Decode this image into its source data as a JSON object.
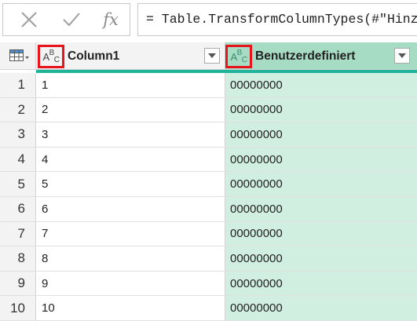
{
  "formula_bar": {
    "cancel_icon": "x-icon",
    "commit_icon": "check-icon",
    "fx_label": "fx",
    "formula": "= Table.TransformColumnTypes(#\"Hinz"
  },
  "table": {
    "corner_icon": "table-icon",
    "columns": [
      {
        "type_label": "ABC",
        "name": "Column1",
        "selected": false
      },
      {
        "type_label": "ABC",
        "name": "Benutzerdefiniert",
        "selected": true
      }
    ],
    "rows": [
      {
        "num": "1",
        "col1": "1",
        "col2": "00000000"
      },
      {
        "num": "2",
        "col1": "2",
        "col2": "00000000"
      },
      {
        "num": "3",
        "col1": "3",
        "col2": "00000000"
      },
      {
        "num": "4",
        "col1": "4",
        "col2": "00000000"
      },
      {
        "num": "5",
        "col1": "5",
        "col2": "00000000"
      },
      {
        "num": "6",
        "col1": "6",
        "col2": "00000000"
      },
      {
        "num": "7",
        "col1": "7",
        "col2": "00000000"
      },
      {
        "num": "8",
        "col1": "8",
        "col2": "00000000"
      },
      {
        "num": "9",
        "col1": "9",
        "col2": "00000000"
      },
      {
        "num": "10",
        "col1": "10",
        "col2": "00000000"
      }
    ]
  },
  "colors": {
    "selected_header": "#a7dcc4",
    "selected_cells": "#d1efe1",
    "accent_line": "#1fb39a",
    "highlight_box": "#e8141c"
  }
}
